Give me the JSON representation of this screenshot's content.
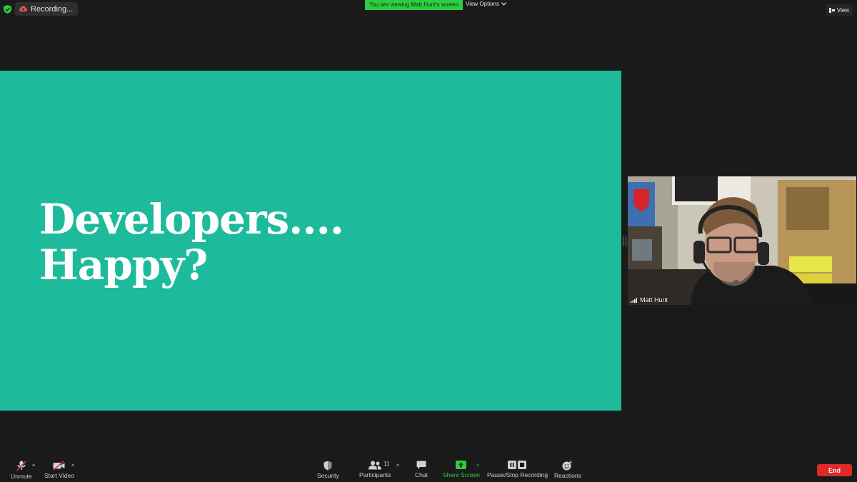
{
  "topbar": {
    "recording_label": "Recording...",
    "viewing_banner": "You are viewing Matt Hunt's screen",
    "view_options_label": "View Options",
    "view_label": "View"
  },
  "slide": {
    "line1": "Developers....",
    "line2": "Happy?",
    "background": "#1dbb9c"
  },
  "video": {
    "participant_name": "Matt Hunt"
  },
  "toolbar": {
    "unmute": "Unmute",
    "start_video": "Start Video",
    "security": "Security",
    "participants": "Participants",
    "participants_count": "11",
    "chat": "Chat",
    "share_screen": "Share Screen",
    "pause_stop_recording": "Pause/Stop Recording",
    "reactions": "Reactions",
    "end": "End"
  },
  "colors": {
    "banner_green": "#2ecc40",
    "share_green": "#2ecc40",
    "end_red": "#e02828"
  }
}
